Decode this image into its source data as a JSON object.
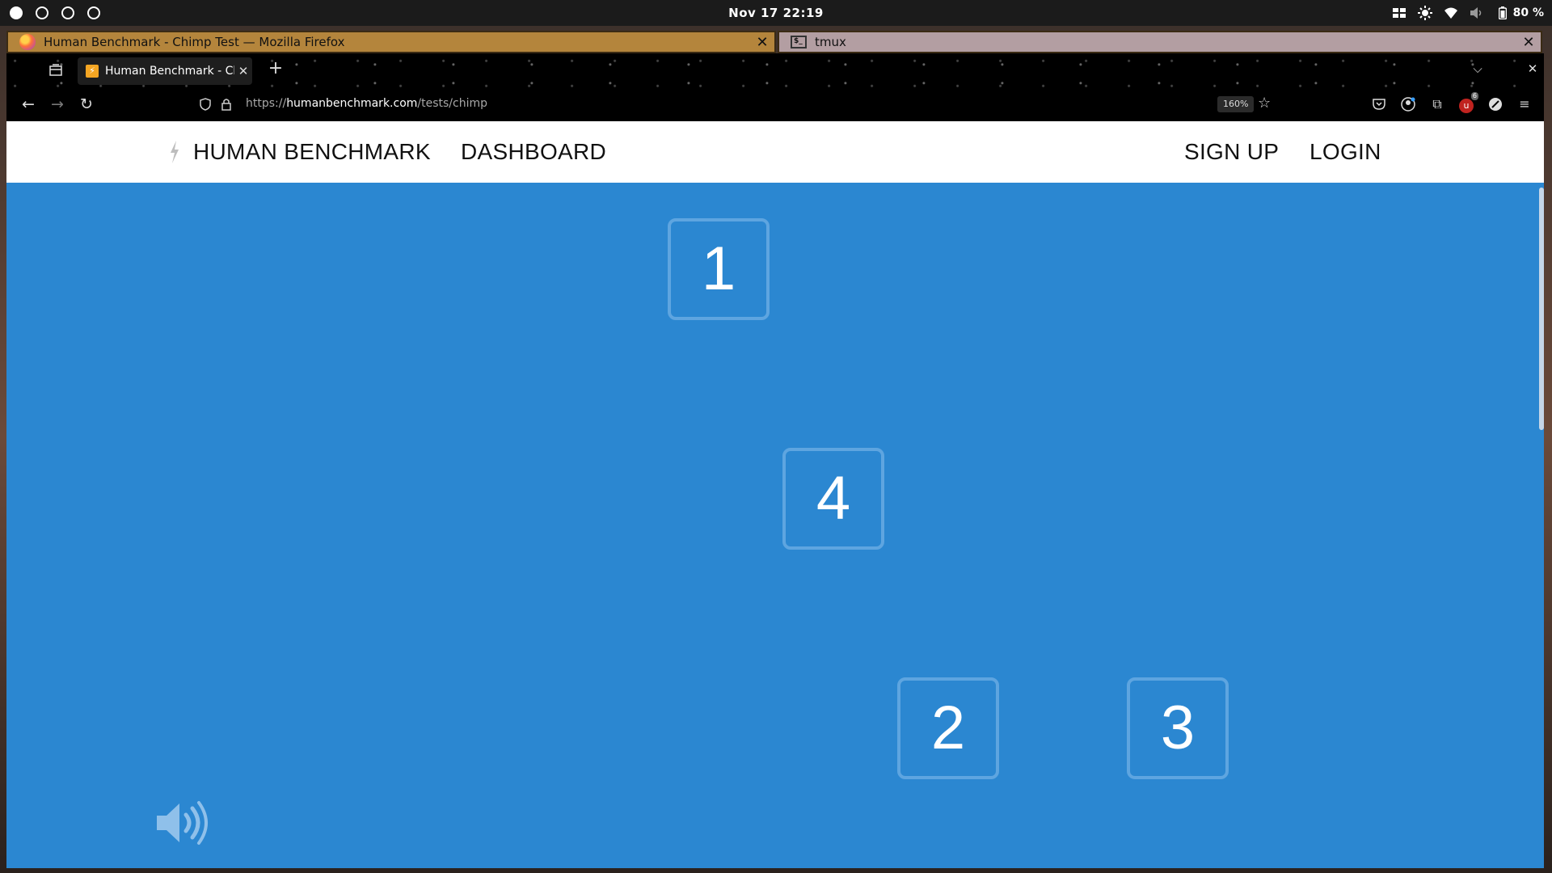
{
  "os": {
    "clock": "Nov 17  22:19",
    "battery": "80 %",
    "tray_icons": [
      "grid-icon",
      "brightness-icon",
      "wifi-icon",
      "volume-icon",
      "battery-icon"
    ]
  },
  "windows": {
    "left_title": "Human Benchmark - Chimp Test — Mozilla Firefox",
    "right_title": "tmux",
    "close_glyph": "✕"
  },
  "browser": {
    "tab_title": "Human Benchmark - Chimp Test",
    "tab_close": "✕",
    "new_tab": "+",
    "url_prefix": "https://",
    "url_host": "humanbenchmark.com",
    "url_path": "/tests/chimp",
    "zoom": "160%",
    "extension_badge": "6"
  },
  "site": {
    "brand": "HUMAN BENCHMARK",
    "nav_dashboard": "DASHBOARD",
    "nav_signup": "SIGN UP",
    "nav_login": "LOGIN",
    "brand_color": "#2b87d1"
  },
  "game": {
    "tiles": [
      "1",
      "4",
      "2",
      "3"
    ]
  }
}
